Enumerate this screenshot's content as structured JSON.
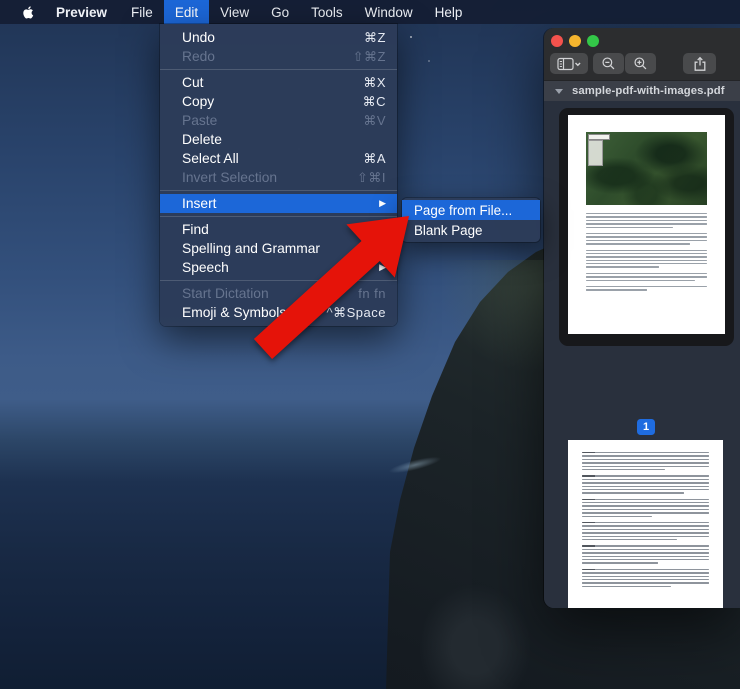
{
  "menu_bar": {
    "apple_icon": "apple-logo-icon",
    "items": [
      {
        "id": "preview",
        "label": "Preview",
        "bold": true,
        "selected": false
      },
      {
        "id": "file",
        "label": "File",
        "selected": false
      },
      {
        "id": "edit",
        "label": "Edit",
        "selected": true
      },
      {
        "id": "view",
        "label": "View",
        "selected": false
      },
      {
        "id": "go",
        "label": "Go",
        "selected": false
      },
      {
        "id": "tools",
        "label": "Tools",
        "selected": false
      },
      {
        "id": "window",
        "label": "Window",
        "selected": false
      },
      {
        "id": "help",
        "label": "Help",
        "selected": false
      }
    ]
  },
  "edit_menu": {
    "items": [
      {
        "label": "Undo",
        "shortcut": "⌘Z",
        "enabled": true
      },
      {
        "label": "Redo",
        "shortcut": "⇧⌘Z",
        "enabled": false
      },
      {
        "separator": true
      },
      {
        "label": "Cut",
        "shortcut": "⌘X",
        "enabled": true
      },
      {
        "label": "Copy",
        "shortcut": "⌘C",
        "enabled": true
      },
      {
        "label": "Paste",
        "shortcut": "⌘V",
        "enabled": false
      },
      {
        "label": "Delete",
        "shortcut": "",
        "enabled": true
      },
      {
        "label": "Select All",
        "shortcut": "⌘A",
        "enabled": true
      },
      {
        "label": "Invert Selection",
        "shortcut": "⇧⌘I",
        "enabled": false
      },
      {
        "separator": true
      },
      {
        "label": "Insert",
        "shortcut": "",
        "enabled": true,
        "highlighted": true,
        "submenu_arrow": true
      },
      {
        "separator": true
      },
      {
        "label": "Find",
        "shortcut": "",
        "enabled": true
      },
      {
        "label": "Spelling and Grammar",
        "shortcut": "",
        "enabled": true
      },
      {
        "label": "Speech",
        "shortcut": "",
        "enabled": true,
        "submenu_arrow": true
      },
      {
        "separator": true
      },
      {
        "label": "Start Dictation",
        "shortcut": "fn fn",
        "enabled": false
      },
      {
        "label": "Emoji & Symbols",
        "shortcut": "^⌘Space",
        "enabled": true
      }
    ]
  },
  "insert_submenu": {
    "items": [
      {
        "label": "Page from File...",
        "enabled": true,
        "highlighted": true
      },
      {
        "label": "Blank Page",
        "enabled": true,
        "highlighted": false
      }
    ]
  },
  "preview_window": {
    "traffic_lights": [
      {
        "name": "close",
        "color": "#f4524d"
      },
      {
        "name": "minimize",
        "color": "#f5b52e"
      },
      {
        "name": "zoom",
        "color": "#33c748"
      }
    ],
    "toolbar_buttons": [
      {
        "name": "sidebar-view-button",
        "icon": "sidebar-icon"
      },
      {
        "name": "zoom-out-button",
        "icon": "zoom-out-icon"
      },
      {
        "name": "zoom-in-button",
        "icon": "zoom-in-icon"
      },
      {
        "name": "share-button",
        "icon": "share-icon"
      }
    ],
    "sidebar": {
      "filename": "sample-pdf-with-images.pdf",
      "page_badge": "1"
    }
  },
  "annotation_arrow": {
    "color": "#e51309",
    "points_to": "Page from File..."
  },
  "colors": {
    "menu_highlight": "#1c67d8",
    "menu_background": "#2c3c59",
    "badge_blue": "#1f6ce0",
    "menubar_background": "#141e34"
  }
}
